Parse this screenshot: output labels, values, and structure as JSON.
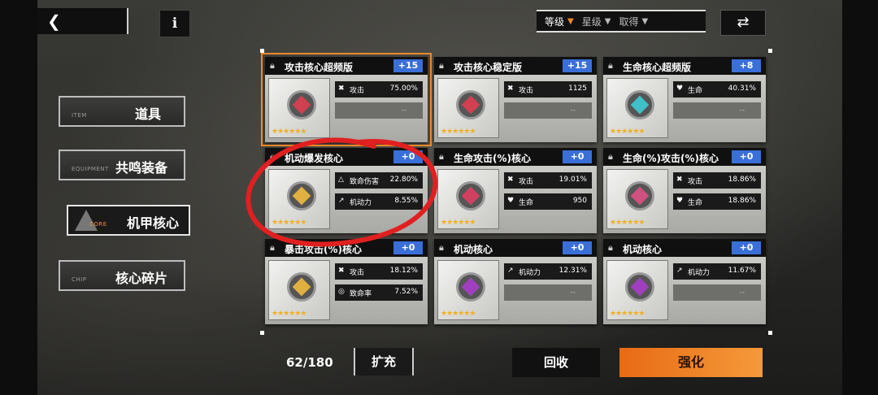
{
  "topbar": {
    "back_icon": "back-chevron-icon",
    "info_label": "i",
    "sort": [
      {
        "label": "等级",
        "active": true
      },
      {
        "label": "星级",
        "active": false
      },
      {
        "label": "取得",
        "active": false
      }
    ],
    "swap_icon": "swap-arrows-icon"
  },
  "nav": [
    {
      "sub": "ITEM",
      "label": "道具"
    },
    {
      "sub": "EQUIPMENT",
      "label": "共鸣装备"
    },
    {
      "sub": "CORE",
      "label": "机甲核心",
      "active": true
    },
    {
      "sub": "CHIP",
      "label": "核心碎片"
    }
  ],
  "cards": [
    {
      "name": "攻击核心超频版",
      "level": "+15",
      "stars": "★★★★★★",
      "stats": [
        {
          "icon": "sword-icon",
          "k": "攻击",
          "v": "75.00%"
        }
      ],
      "empty": "--",
      "accent": "#d04050",
      "selected": true
    },
    {
      "name": "攻击核心稳定版",
      "level": "+15",
      "stars": "★★★★★★",
      "stats": [
        {
          "icon": "sword-icon",
          "k": "攻击",
          "v": "1125"
        }
      ],
      "empty": "--",
      "accent": "#d04050"
    },
    {
      "name": "生命核心超频版",
      "level": "+8",
      "stars": "★★★★★★",
      "stats": [
        {
          "icon": "heart-icon",
          "k": "生命",
          "v": "40.31%"
        }
      ],
      "empty": "--",
      "accent": "#40c0c8"
    },
    {
      "name": "机动爆发核心",
      "level": "+0",
      "stars": "★★★★★★",
      "stats": [
        {
          "icon": "crit-icon",
          "k": "致命伤害",
          "v": "22.80%"
        },
        {
          "icon": "boot-icon",
          "k": "机动力",
          "v": "8.55%"
        }
      ],
      "accent": "#e0b040"
    },
    {
      "name": "生命攻击(%)核心",
      "level": "+0",
      "stars": "★★★★★★",
      "stats": [
        {
          "icon": "sword-icon",
          "k": "攻击",
          "v": "19.01%"
        },
        {
          "icon": "heart-icon",
          "k": "生命",
          "v": "950"
        }
      ],
      "accent": "#d04060"
    },
    {
      "name": "生命(%)攻击(%)核心",
      "level": "+0",
      "stars": "★★★★★★",
      "stats": [
        {
          "icon": "sword-icon",
          "k": "攻击",
          "v": "18.86%"
        },
        {
          "icon": "heart-icon",
          "k": "生命",
          "v": "18.86%"
        }
      ],
      "accent": "#d05080"
    },
    {
      "name": "暴击攻击(%)核心",
      "level": "+0",
      "stars": "★★★★★★",
      "stats": [
        {
          "icon": "sword-icon",
          "k": "攻击",
          "v": "18.12%"
        },
        {
          "icon": "target-icon",
          "k": "致命率",
          "v": "7.52%"
        }
      ],
      "accent": "#e0b040"
    },
    {
      "name": "机动核心",
      "level": "+0",
      "stars": "★★★★★★",
      "stats": [
        {
          "icon": "boot-icon",
          "k": "机动力",
          "v": "12.31%"
        }
      ],
      "empty": "--",
      "accent": "#a040c0"
    },
    {
      "name": "机动核心",
      "level": "+0",
      "stars": "★★★★★★",
      "stats": [
        {
          "icon": "boot-icon",
          "k": "机动力",
          "v": "11.67%"
        }
      ],
      "empty": "--",
      "accent": "#a040c0"
    }
  ],
  "bottom": {
    "capacity": "62/180",
    "expand_label": "扩充",
    "recycle_label": "回收",
    "enhance_label": "强化"
  }
}
